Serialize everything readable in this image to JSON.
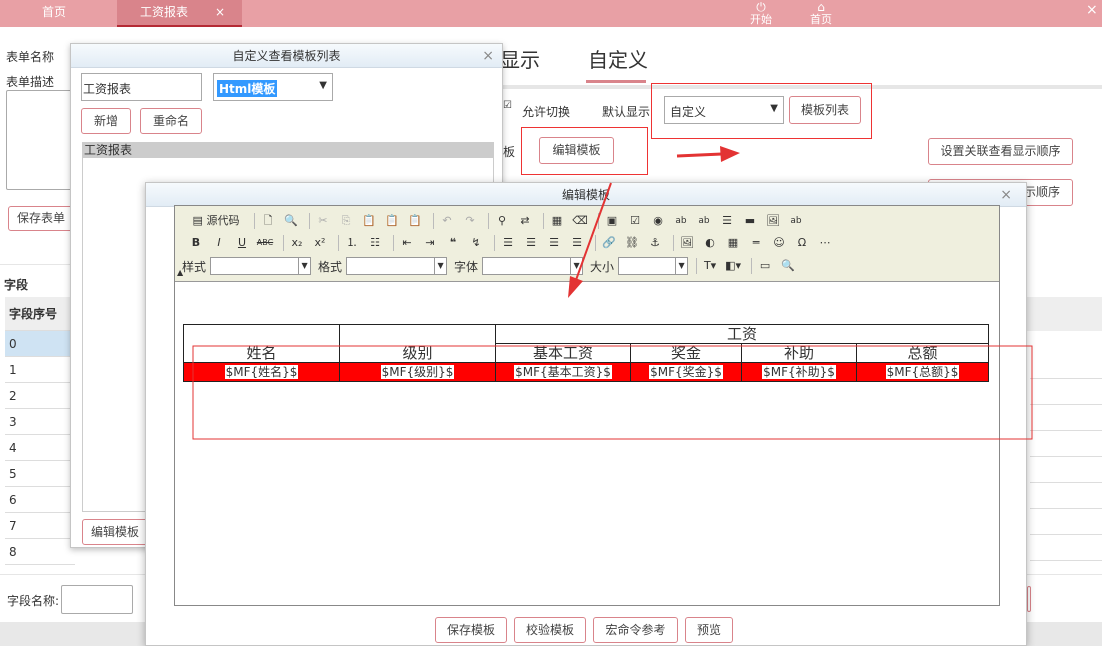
{
  "topbar": {
    "tab_home": "首页",
    "tab_active": "工资报表",
    "tab_close": "×",
    "start_label": "开始",
    "home_label": "首页",
    "corner_close": "×"
  },
  "form": {
    "name_label": "表单名称",
    "desc_label": "表单描述",
    "save_form": "保存表单",
    "tab_display": "显示",
    "tab_custom": "自定义",
    "allow_switch": "允许切换",
    "default_display": "默认显示",
    "default_value": "自定义",
    "template_list_btn": "模板列表",
    "edit_template_btn": "编辑模板",
    "partial_label": "板",
    "set_order_btn": "设置关联查看显示顺序",
    "set_order_btn2": "示顺序",
    "field_section": "字段",
    "field_col": "字段序号",
    "field_rows": [
      "0",
      "1",
      "2",
      "3",
      "4",
      "5",
      "6",
      "7",
      "8"
    ],
    "field_name_label": "字段名称:"
  },
  "list_dialog": {
    "title": "自定义查看模板列表",
    "close": "×",
    "name_value": "工资报表",
    "type_value": "Html模板",
    "add_btn": "新增",
    "rename_btn": "重命名",
    "items": [
      "工资报表"
    ],
    "edit_btn": "编辑模板"
  },
  "editor_dialog": {
    "title": "编辑模板",
    "close": "×",
    "toolbar": {
      "source": "源代码",
      "style_label": "样式",
      "format_label": "格式",
      "font_label": "字体",
      "size_label": "大小"
    },
    "table": {
      "col_name": "姓名",
      "col_level": "级别",
      "col_salary": "工资",
      "sub_basic": "基本工资",
      "sub_bonus": "奖金",
      "sub_allowance": "补助",
      "sub_total": "总额",
      "fields": [
        "$MF{姓名}$",
        "$MF{级别}$",
        "$MF{基本工资}$",
        "$MF{奖金}$",
        "$MF{补助}$",
        "$MF{总额}$"
      ]
    },
    "buttons": {
      "save": "保存模板",
      "verify": "校验模板",
      "macro": "宏命令参考",
      "preview": "预览"
    }
  },
  "colors": {
    "topbar": "#e8a0a5",
    "accent": "#d9848b",
    "annotation": "#e33333",
    "field_marker": "#ff0000"
  }
}
